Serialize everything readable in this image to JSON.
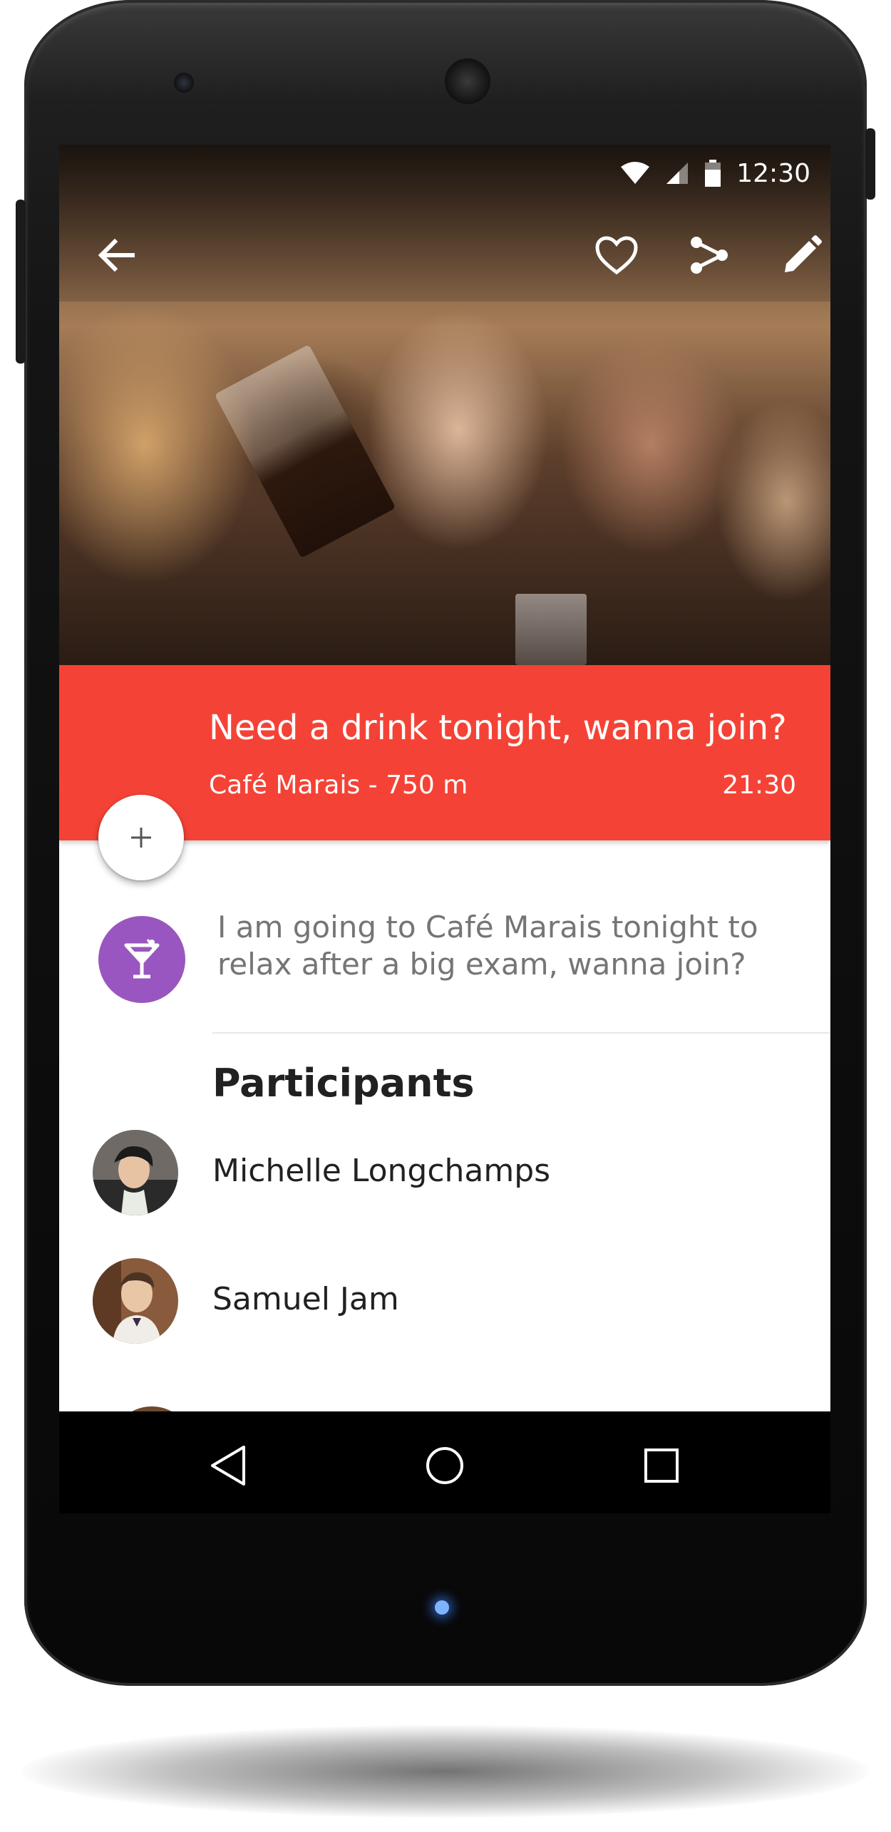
{
  "status_bar": {
    "time": "12:30",
    "icons": [
      "wifi-icon",
      "cell-signal-icon",
      "battery-icon"
    ]
  },
  "app_bar": {
    "icons": [
      "back-arrow-icon",
      "heart-icon",
      "share-icon",
      "edit-pencil-icon"
    ]
  },
  "event": {
    "title": "Need a drink tonight, wanna join?",
    "place": "Café Marais - 750 m",
    "time": "21:30",
    "description": "I am going to Café Marais tonight to relax after a big exam, wanna join?",
    "category_icon": "cocktail-icon",
    "category_color": "#9a56c0",
    "accent_color": "#f44336"
  },
  "fab": {
    "label": "+"
  },
  "participants": {
    "title": "Participants",
    "items": [
      {
        "name": "Michelle Longchamps"
      },
      {
        "name": "Samuel Jam"
      }
    ]
  },
  "nav_bar": {
    "icons": [
      "back-triangle-icon",
      "home-circle-icon",
      "recents-square-icon"
    ]
  }
}
